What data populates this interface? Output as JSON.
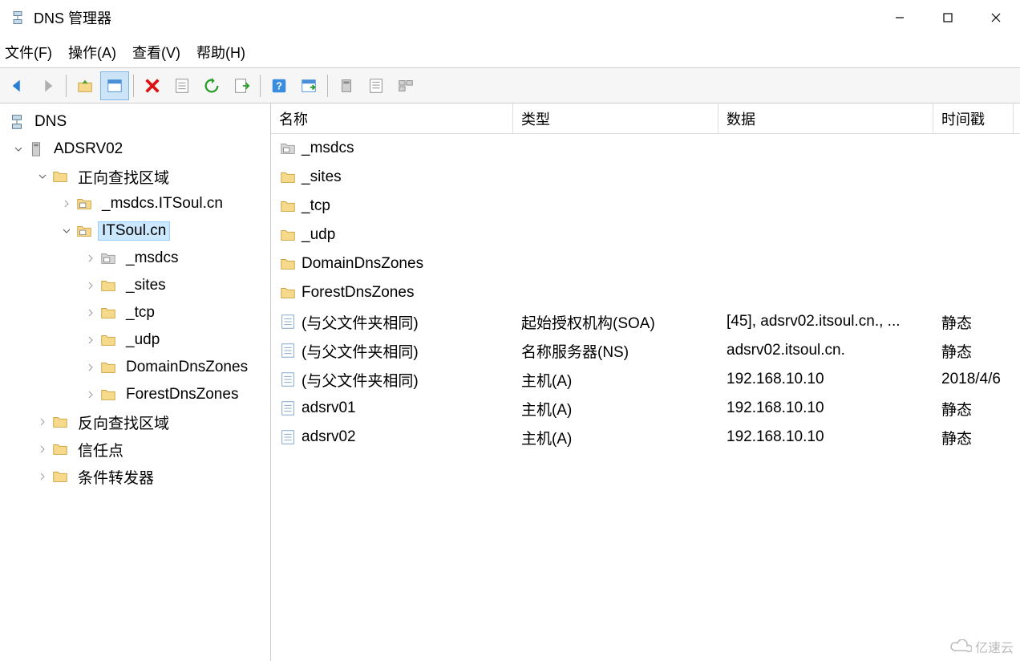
{
  "window": {
    "title": "DNS 管理器"
  },
  "menu": {
    "file": "文件(F)",
    "action": "操作(A)",
    "view": "查看(V)",
    "help": "帮助(H)"
  },
  "toolbar_icons": {
    "back": "back-icon",
    "forward": "forward-icon",
    "up": "up-folder-icon",
    "show": "show-pane-icon",
    "delete": "delete-icon",
    "props": "properties-icon",
    "refresh": "refresh-icon",
    "export": "export-icon",
    "help": "help-icon",
    "tile": "tile-icon",
    "serv1": "server-icon",
    "serv2": "list-icon",
    "serv3": "detail-icon"
  },
  "tree": {
    "root": "DNS",
    "server": "ADSRV02",
    "fwd_zone": "正向查找区域",
    "msdcs_zone": "_msdcs.ITSoul.cn",
    "itsoul_zone": "ITSoul.cn",
    "sub": {
      "msdcs": "_msdcs",
      "sites": "_sites",
      "tcp": "_tcp",
      "udp": "_udp",
      "ddz": "DomainDnsZones",
      "fdz": "ForestDnsZones"
    },
    "rev_zone": "反向查找区域",
    "trust": "信任点",
    "cond": "条件转发器"
  },
  "columns": {
    "name": "名称",
    "type": "类型",
    "data": "数据",
    "ts": "时间戳"
  },
  "rows": [
    {
      "name": "_msdcs",
      "type": "",
      "data": "",
      "ts": "",
      "icon": "zone"
    },
    {
      "name": "_sites",
      "type": "",
      "data": "",
      "ts": "",
      "icon": "folder"
    },
    {
      "name": "_tcp",
      "type": "",
      "data": "",
      "ts": "",
      "icon": "folder"
    },
    {
      "name": "_udp",
      "type": "",
      "data": "",
      "ts": "",
      "icon": "folder"
    },
    {
      "name": "DomainDnsZones",
      "type": "",
      "data": "",
      "ts": "",
      "icon": "folder"
    },
    {
      "name": "ForestDnsZones",
      "type": "",
      "data": "",
      "ts": "",
      "icon": "folder"
    },
    {
      "name": "(与父文件夹相同)",
      "type": "起始授权机构(SOA)",
      "data": "[45], adsrv02.itsoul.cn., ...",
      "ts": "静态",
      "icon": "record"
    },
    {
      "name": "(与父文件夹相同)",
      "type": "名称服务器(NS)",
      "data": "adsrv02.itsoul.cn.",
      "ts": "静态",
      "icon": "record"
    },
    {
      "name": "(与父文件夹相同)",
      "type": "主机(A)",
      "data": "192.168.10.10",
      "ts": "2018/4/6",
      "icon": "record"
    },
    {
      "name": "adsrv01",
      "type": "主机(A)",
      "data": "192.168.10.10",
      "ts": "静态",
      "icon": "record"
    },
    {
      "name": "adsrv02",
      "type": "主机(A)",
      "data": "192.168.10.10",
      "ts": "静态",
      "icon": "record"
    }
  ],
  "watermark": "亿速云"
}
